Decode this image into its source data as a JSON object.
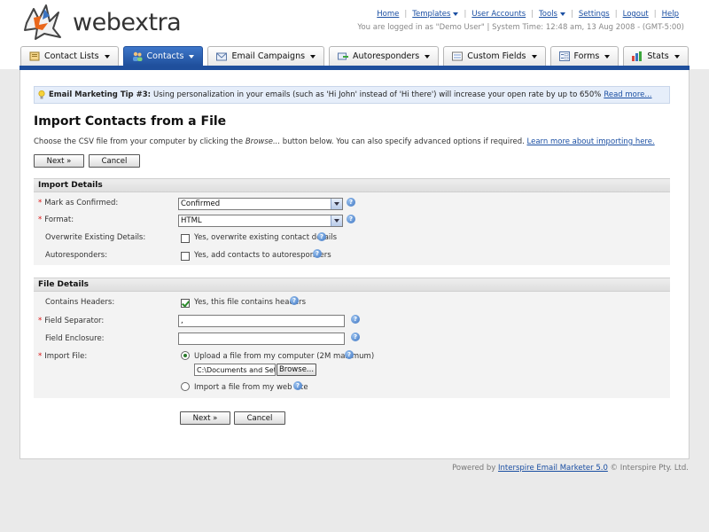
{
  "brand": {
    "name": "webextra"
  },
  "top_links": [
    "Home",
    "Templates",
    "User Accounts",
    "Tools",
    "Settings",
    "Logout",
    "Help"
  ],
  "login_info": "You are logged in as \"Demo User\" | System Time: 12:48 am, 13 Aug 2008 - (GMT-5:00)",
  "tabs": [
    {
      "label": "Contact Lists",
      "icon": "contact-lists-icon",
      "active": false
    },
    {
      "label": "Contacts",
      "icon": "contacts-icon",
      "active": true
    },
    {
      "label": "Email Campaigns",
      "icon": "envelope-icon",
      "active": false
    },
    {
      "label": "Autoresponders",
      "icon": "autoresponder-icon",
      "active": false
    },
    {
      "label": "Custom Fields",
      "icon": "custom-fields-icon",
      "active": false
    },
    {
      "label": "Forms",
      "icon": "forms-icon",
      "active": false
    },
    {
      "label": "Stats",
      "icon": "stats-icon",
      "active": false
    }
  ],
  "tip": {
    "title": "Email Marketing Tip #3:",
    "text": "Using personalization in your emails (such as 'Hi John' instead of 'Hi there') will increase your open rate by up to 650%",
    "link": "Read more..."
  },
  "page": {
    "title": "Import Contacts from a File",
    "intro_before": "Choose the CSV file from your computer by clicking the ",
    "intro_italic": "Browse...",
    "intro_after": " button below. You can also specify advanced options if required.",
    "intro_link": "Learn more about importing here."
  },
  "buttons": {
    "next": "Next »",
    "cancel": "Cancel",
    "browse": "Browse..."
  },
  "import_details": {
    "heading": "Import Details",
    "mark_confirmed": {
      "label": "Mark as Confirmed:",
      "value": "Confirmed"
    },
    "format": {
      "label": "Format:",
      "value": "HTML"
    },
    "overwrite": {
      "label": "Overwrite Existing Details:",
      "option": "Yes, overwrite existing contact details",
      "checked": false
    },
    "autoresponders": {
      "label": "Autoresponders:",
      "option": "Yes, add contacts to autoresponders",
      "checked": false
    }
  },
  "file_details": {
    "heading": "File Details",
    "contains_headers": {
      "label": "Contains Headers:",
      "option": "Yes, this file contains headers",
      "checked": true
    },
    "field_separator": {
      "label": "Field Separator:",
      "value": ","
    },
    "field_enclosure": {
      "label": "Field Enclosure:",
      "value": ""
    },
    "import_file": {
      "label": "Import File:",
      "upload_option": "Upload a file from my computer (2M maximum)",
      "file_path": "C:\\Documents and Settings",
      "web_option": "Import a file from my web site"
    }
  },
  "footer": {
    "before": "Powered by ",
    "link": "Interspire Email Marketer 5.0",
    "after": " © Interspire Pty. Ltd."
  },
  "colors": {
    "accent": "#1f4f9c",
    "link": "#1a4ea2",
    "required": "#dd1111"
  }
}
